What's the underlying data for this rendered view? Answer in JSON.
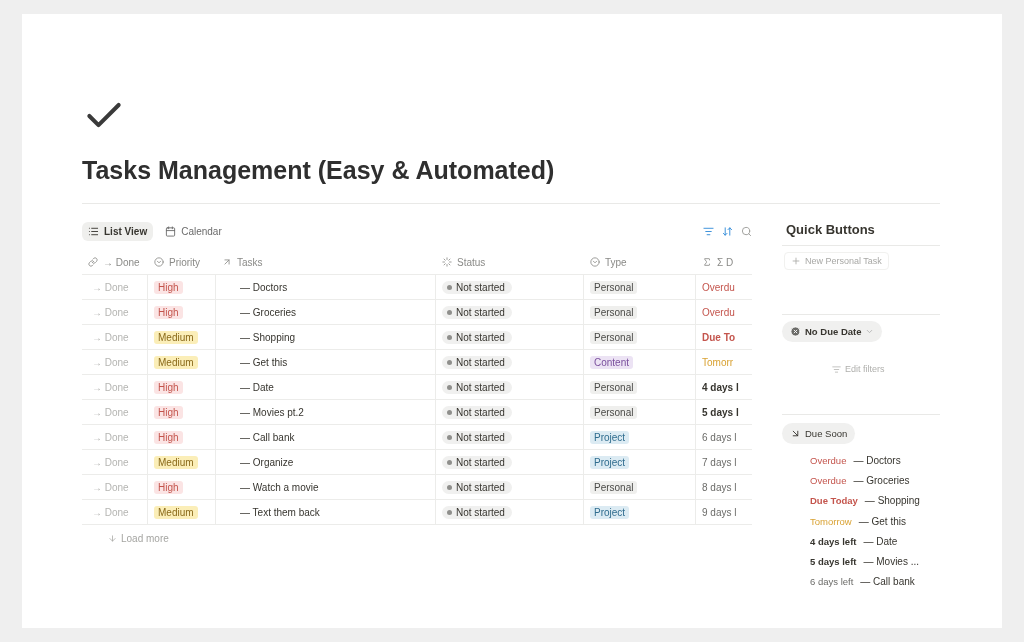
{
  "page": {
    "title": "Tasks Management (Easy & Automated)"
  },
  "views": [
    {
      "label": "List View",
      "selected": true
    },
    {
      "label": "Calendar",
      "selected": false
    }
  ],
  "table": {
    "columns": [
      "→ Done",
      "Priority",
      "Tasks",
      "Status",
      "Type",
      "Σ D"
    ],
    "rows": [
      {
        "done": "→ Done",
        "priority": {
          "label": "High",
          "kind": "high"
        },
        "task": "— Doctors",
        "status": "Not started",
        "type": {
          "label": "Personal",
          "kind": "personal"
        },
        "due": {
          "label": "Overdu",
          "kind": "overdue"
        }
      },
      {
        "done": "→ Done",
        "priority": {
          "label": "High",
          "kind": "high"
        },
        "task": "— Groceries",
        "status": "Not started",
        "type": {
          "label": "Personal",
          "kind": "personal"
        },
        "due": {
          "label": "Overdu",
          "kind": "overdue"
        }
      },
      {
        "done": "→ Done",
        "priority": {
          "label": "Medium",
          "kind": "medium"
        },
        "task": "— Shopping",
        "status": "Not started",
        "type": {
          "label": "Personal",
          "kind": "personal"
        },
        "due": {
          "label": "Due To",
          "kind": "today"
        }
      },
      {
        "done": "→ Done",
        "priority": {
          "label": "Medium",
          "kind": "medium"
        },
        "task": "— Get this",
        "status": "Not started",
        "type": {
          "label": "Content",
          "kind": "content"
        },
        "due": {
          "label": "Tomorr",
          "kind": "tomorrow"
        }
      },
      {
        "done": "→ Done",
        "priority": {
          "label": "High",
          "kind": "high"
        },
        "task": "— Date",
        "status": "Not started",
        "type": {
          "label": "Personal",
          "kind": "personal"
        },
        "due": {
          "label": "4 days l",
          "kind": "near"
        }
      },
      {
        "done": "→ Done",
        "priority": {
          "label": "High",
          "kind": "high"
        },
        "task": "— Movies pt.2",
        "status": "Not started",
        "type": {
          "label": "Personal",
          "kind": "personal"
        },
        "due": {
          "label": "5 days l",
          "kind": "near"
        }
      },
      {
        "done": "→ Done",
        "priority": {
          "label": "High",
          "kind": "high"
        },
        "task": "— Call bank",
        "status": "Not started",
        "type": {
          "label": "Project",
          "kind": "project"
        },
        "due": {
          "label": "6 days l",
          "kind": "far"
        }
      },
      {
        "done": "→ Done",
        "priority": {
          "label": "Medium",
          "kind": "medium"
        },
        "task": "— Organize",
        "status": "Not started",
        "type": {
          "label": "Project",
          "kind": "project"
        },
        "due": {
          "label": "7 days l",
          "kind": "far"
        }
      },
      {
        "done": "→ Done",
        "priority": {
          "label": "High",
          "kind": "high"
        },
        "task": "— Watch a movie",
        "status": "Not started",
        "type": {
          "label": "Personal",
          "kind": "personal"
        },
        "due": {
          "label": "8 days l",
          "kind": "far"
        }
      },
      {
        "done": "→ Done",
        "priority": {
          "label": "Medium",
          "kind": "medium"
        },
        "task": "— Text them back",
        "status": "Not started",
        "type": {
          "label": "Project",
          "kind": "project"
        },
        "due": {
          "label": "9 days l",
          "kind": "far"
        }
      }
    ],
    "load_more": "Load more"
  },
  "quick_buttons": {
    "title": "Quick Buttons",
    "button": "New Personal Task"
  },
  "filter": {
    "chip": "No Due Date",
    "edit": "Edit filters"
  },
  "due_soon": {
    "title": "Due Soon",
    "items": [
      {
        "when": "Overdue",
        "kind": "overdue",
        "task": "— Doctors"
      },
      {
        "when": "Overdue",
        "kind": "overdue",
        "task": "— Groceries"
      },
      {
        "when": "Due Today",
        "kind": "today",
        "task": "— Shopping"
      },
      {
        "when": "Tomorrow",
        "kind": "tomorrow",
        "task": "— Get this"
      },
      {
        "when": "4 days left",
        "kind": "near",
        "task": "— Date"
      },
      {
        "when": "5 days left",
        "kind": "near",
        "task": "— Movies ..."
      },
      {
        "when": "6 days left",
        "kind": "far",
        "task": "— Call bank"
      }
    ]
  }
}
